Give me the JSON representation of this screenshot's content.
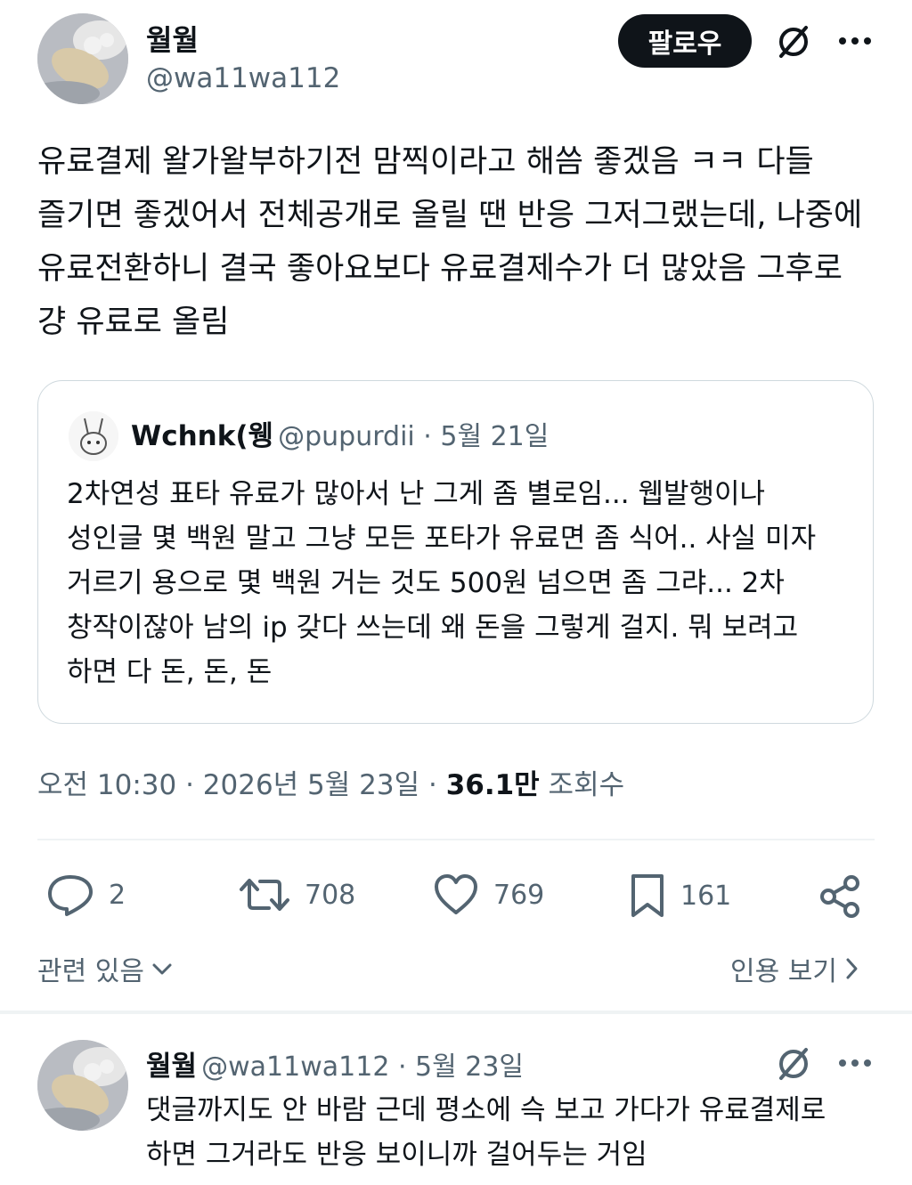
{
  "main_tweet": {
    "author_name": "월월",
    "author_handle": "@wa11wa112",
    "follow_label": "팔로우",
    "text": "유료결제 왈가왈부하기전 맘찍이라고 해씀 좋겠음 ㅋㅋ 다들 즐기면 좋겠어서 전체공개로 올릴 땐 반응 그저그랬는데, 나중에 유료전환하니 결국 좋아요보다 유료결제수가 더 많았음 그후로 걍 유료로 올림",
    "timestamp": "오전 10:30 · 2026년 5월 23일 · ",
    "views_count": "36.1만",
    "views_label": " 조회수"
  },
  "quoted_tweet": {
    "author_name": "Wchnk(웽",
    "author_handle": "@pupurdii",
    "date": " · 5월 21일",
    "text": "2차연성 표타 유료가 많아서 난 그게 좀 별로임... 웹발행이나 성인글 몇 백원 말고 그냥 모든 포타가 유료면 좀 식어.. 사실 미자 거르기 용으로 몇 백원 거는 것도 500원 넘으면 좀 그랴... 2차 창작이잖아 남의 ip 갖다 쓰는데 왜 돈을 그렇게 걸지. 뭐 보려고 하면 다 돈, 돈, 돈"
  },
  "actions": {
    "replies": "2",
    "retweets": "708",
    "likes": "769",
    "bookmarks": "161"
  },
  "links": {
    "related": "관련 있음",
    "quotes": "인용 보기"
  },
  "reply_tweet": {
    "author_name": "월월",
    "author_handle": "@wa11wa112",
    "date": " · 5월 23일",
    "text": "댓글까지도 안 바람 근데 평소에 슥 보고 가다가 유료결제로 하면 그거라도 반응 보이니까 걸어두는 거임"
  },
  "icons": {
    "avatar": "avatar-photo",
    "grok": "grok-icon",
    "more": "more-icon",
    "reply": "reply-icon",
    "retweet": "retweet-icon",
    "like": "heart-icon",
    "bookmark": "bookmark-icon",
    "share": "share-icon"
  },
  "colors": {
    "text": "#0f1419",
    "secondary": "#536471",
    "border": "#cfd9de",
    "follow_bg": "#0f1419"
  }
}
